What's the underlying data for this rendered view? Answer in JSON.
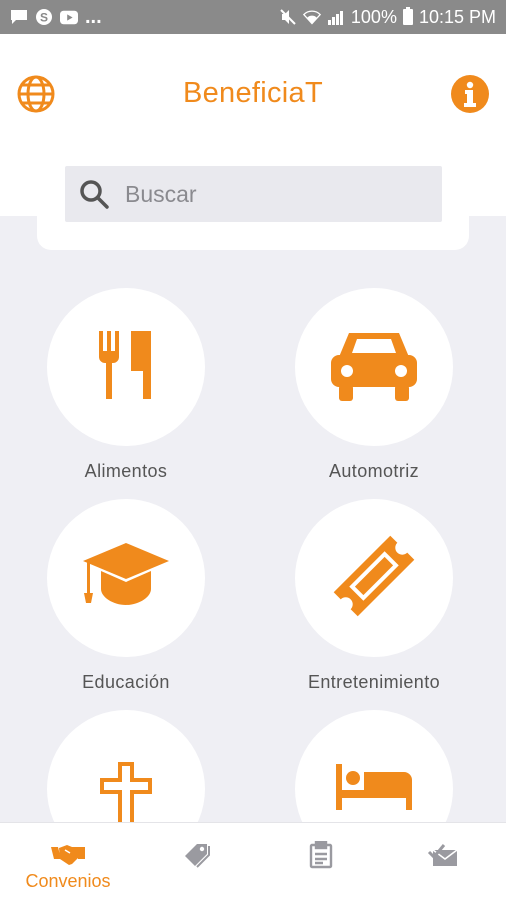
{
  "status_bar": {
    "notification_icons": [
      "chat-icon",
      "skype-icon",
      "youtube-icon"
    ],
    "overflow": "...",
    "icons": [
      "mute-icon",
      "wifi-icon",
      "signal-icon"
    ],
    "battery": "100%",
    "time": "10:15 PM"
  },
  "header": {
    "title": "BeneficiaT",
    "left_icon": "globe-icon",
    "right_icon": "info-icon"
  },
  "search": {
    "placeholder": "Buscar",
    "value": ""
  },
  "categories": [
    {
      "label": "Alimentos",
      "icon": "utensils-icon"
    },
    {
      "label": "Automotriz",
      "icon": "car-icon"
    },
    {
      "label": "Educación",
      "icon": "graduation-cap-icon"
    },
    {
      "label": "Entretenimiento",
      "icon": "ticket-icon"
    },
    {
      "label": "",
      "icon": "cross-icon"
    },
    {
      "label": "",
      "icon": "bed-icon"
    }
  ],
  "bottom_nav": [
    {
      "label": "Convenios",
      "icon": "handshake-icon",
      "active": true
    },
    {
      "label": "",
      "icon": "tags-icon",
      "active": false
    },
    {
      "label": "",
      "icon": "clipboard-icon",
      "active": false
    },
    {
      "label": "",
      "icon": "envelope-check-icon",
      "active": false
    }
  ],
  "colors": {
    "accent": "#f08a1c",
    "status_bar": "#8a8a8a",
    "background": "#efeff4",
    "inactive_icon": "#9a9aa0"
  }
}
